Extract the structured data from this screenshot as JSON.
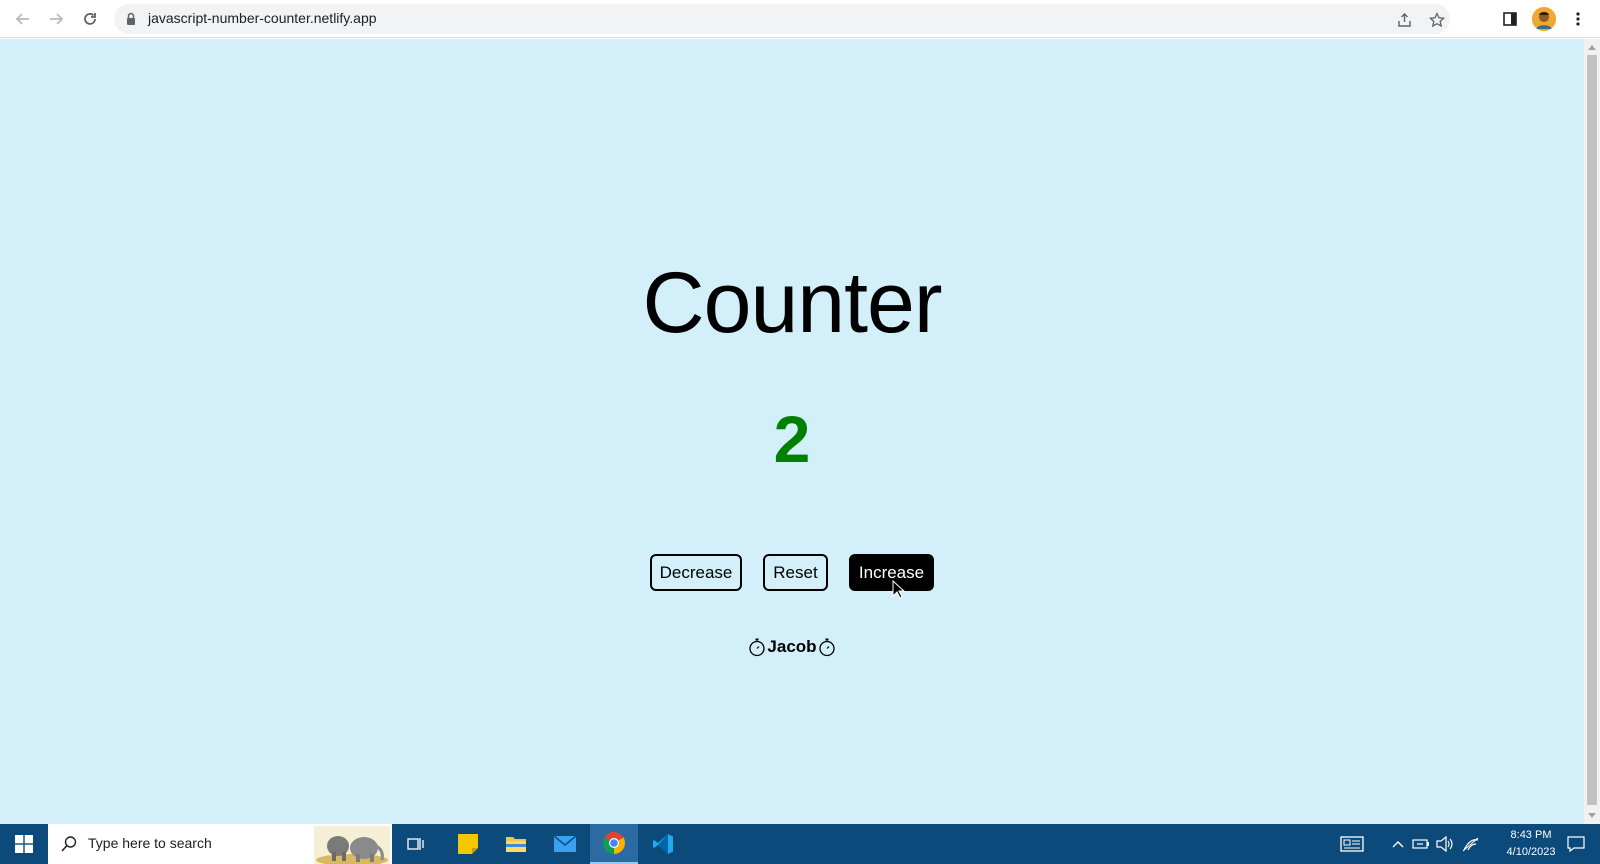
{
  "browser": {
    "url": "javascript-number-counter.netlify.app",
    "back_icon": "arrow-left-icon",
    "forward_icon": "arrow-right-icon",
    "reload_icon": "reload-icon"
  },
  "page": {
    "title": "Counter",
    "count": "2",
    "count_color": "#008000",
    "background": "#d3eff9",
    "buttons": {
      "decrease": "Decrease",
      "reset": "Reset",
      "increase": "Increase"
    },
    "credit_name": "Jacob"
  },
  "taskbar": {
    "search_placeholder": "Type here to search",
    "time": "8:43 PM",
    "date": "4/10/2023"
  }
}
